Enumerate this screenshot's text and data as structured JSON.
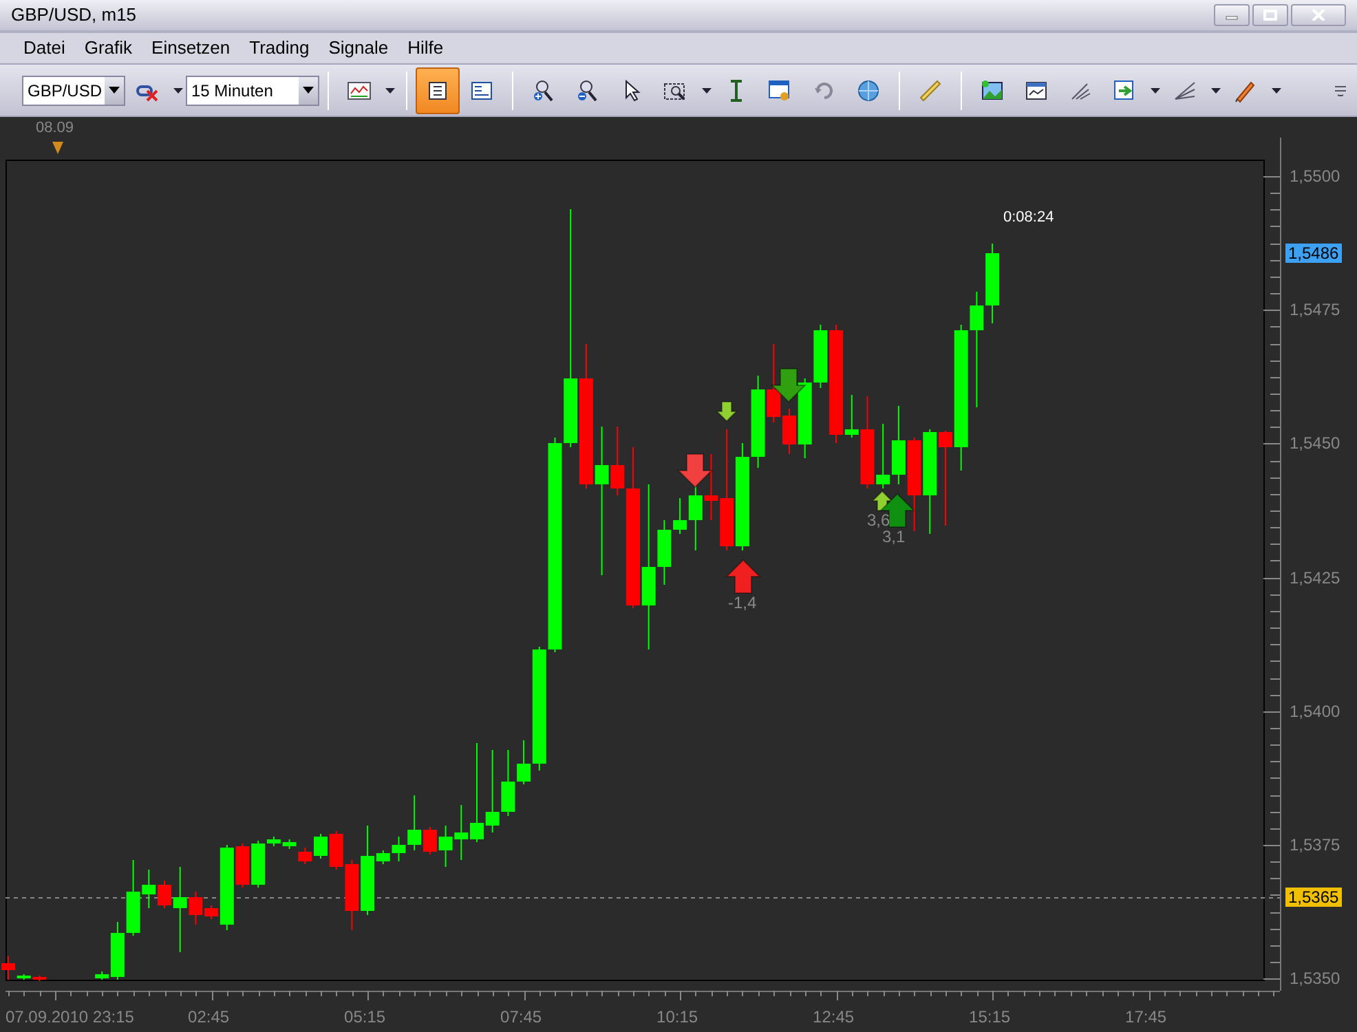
{
  "window": {
    "title": "GBP/USD, m15"
  },
  "menu": [
    "Datei",
    "Grafik",
    "Einsetzen",
    "Trading",
    "Signale",
    "Hilfe"
  ],
  "toolbar": {
    "symbol": "GBP/USD",
    "timeframe": "15 Minuten",
    "tools": [
      {
        "kind": "indicator-off",
        "selected": false,
        "has_menu": true
      },
      {
        "kind": "chart-line",
        "selected": false,
        "has_menu": true
      },
      {
        "kind": "bars-view",
        "selected": true,
        "has_menu": false
      },
      {
        "kind": "text-view",
        "selected": false,
        "has_menu": false
      },
      {
        "kind": "zoom-in",
        "selected": false,
        "has_menu": false
      },
      {
        "kind": "zoom-out",
        "selected": false,
        "has_menu": false
      },
      {
        "kind": "cursor",
        "selected": false,
        "has_menu": false
      },
      {
        "kind": "zoom-rect",
        "selected": false,
        "has_menu": true
      },
      {
        "kind": "vline",
        "selected": false,
        "has_menu": false
      },
      {
        "kind": "properties",
        "selected": false,
        "has_menu": false
      },
      {
        "kind": "refresh",
        "selected": false,
        "has_menu": false
      },
      {
        "kind": "globe",
        "selected": false,
        "has_menu": false
      },
      {
        "kind": "ruler",
        "selected": false,
        "has_menu": false
      },
      {
        "kind": "image",
        "selected": false,
        "has_menu": false
      },
      {
        "kind": "template",
        "selected": false,
        "has_menu": false
      },
      {
        "kind": "fork",
        "selected": false,
        "has_menu": false
      },
      {
        "kind": "export",
        "selected": false,
        "has_menu": true
      },
      {
        "kind": "fan",
        "selected": false,
        "has_menu": true
      },
      {
        "kind": "pencil",
        "selected": false,
        "has_menu": true
      }
    ]
  },
  "chart": {
    "date_marker": "08.09",
    "countdown": "0:08:24",
    "price_labels": [
      "1,5500",
      "1,5475",
      "1,5450",
      "1,5425",
      "1,5400",
      "1,5375",
      "1,5350"
    ],
    "price_badges": [
      {
        "label": "1,5486",
        "color": "#3ea0f0"
      },
      {
        "label": "1,5365",
        "color": "#f0c000"
      }
    ],
    "time_labels": [
      "07.09.2010 23:15",
      "02:45",
      "05:15",
      "07:45",
      "10:15",
      "12:45",
      "15:15",
      "17:45"
    ],
    "signals": [
      {
        "kind": "sell"
      },
      {
        "kind": "buy",
        "label": "-1,4"
      },
      {
        "kind": "sell-minor"
      },
      {
        "kind": "sell"
      },
      {
        "kind": "buy-minor",
        "label": "3,6"
      },
      {
        "kind": "buy",
        "label": "3,1"
      }
    ]
  }
}
